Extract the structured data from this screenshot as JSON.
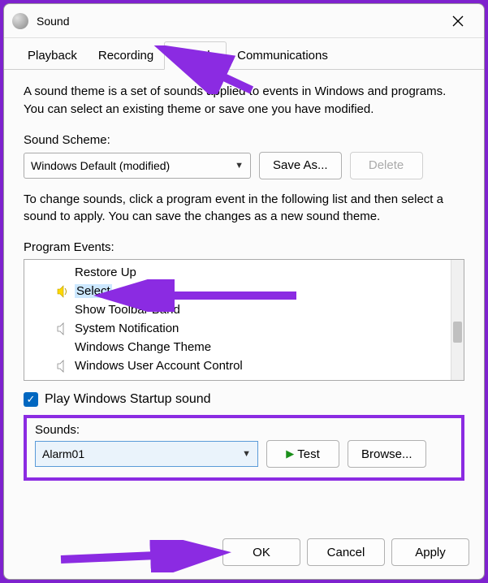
{
  "window": {
    "title": "Sound"
  },
  "tabs": [
    {
      "label": "Playback"
    },
    {
      "label": "Recording"
    },
    {
      "label": "Sounds"
    },
    {
      "label": "Communications"
    }
  ],
  "description": "A sound theme is a set of sounds applied to events in Windows and programs. You can select an existing theme or save one you have modified.",
  "scheme": {
    "label": "Sound Scheme:",
    "value": "Windows Default (modified)",
    "save_as": "Save As...",
    "delete": "Delete"
  },
  "events_desc": "To change sounds, click a program event in the following list and then select a sound to apply. You can save the changes as a new sound theme.",
  "events_label": "Program Events:",
  "events": [
    {
      "label": "Restore Up",
      "icon": "none"
    },
    {
      "label": "Select",
      "icon": "yellow",
      "selected": true
    },
    {
      "label": "Show Toolbar Band",
      "icon": "none"
    },
    {
      "label": "System Notification",
      "icon": "grey"
    },
    {
      "label": "Windows Change Theme",
      "icon": "none"
    },
    {
      "label": "Windows User Account Control",
      "icon": "grey"
    }
  ],
  "startup": {
    "label": "Play Windows Startup sound",
    "checked": true
  },
  "sounds": {
    "label": "Sounds:",
    "value": "Alarm01",
    "test": "Test",
    "browse": "Browse..."
  },
  "footer": {
    "ok": "OK",
    "cancel": "Cancel",
    "apply": "Apply"
  }
}
